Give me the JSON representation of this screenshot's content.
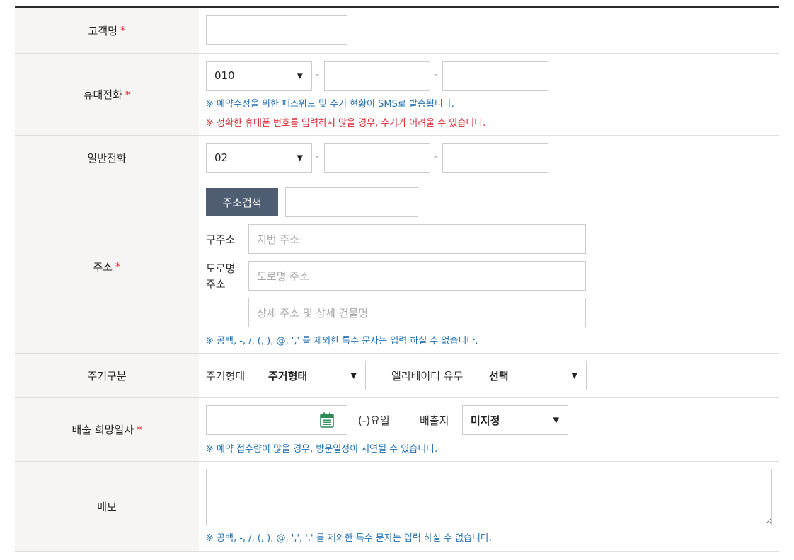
{
  "required_mark": "*",
  "rows": {
    "name": {
      "label": "고객명"
    },
    "mobile": {
      "label": "휴대전화",
      "prefix_value": "010",
      "dash": "-",
      "note_blue": "※ 예약수정을 위한 패스워드 및 수거 현황이 SMS로 발송됩니다.",
      "note_red": "※ 정확한 휴대폰 번호를 입력하지 않을 경우, 수거가 어려울 수 있습니다."
    },
    "phone": {
      "label": "일반전화",
      "prefix_value": "02",
      "dash": "-"
    },
    "address": {
      "label": "주소",
      "search_button": "주소검색",
      "old_label": "구주소",
      "old_placeholder": "지번 주소",
      "road_label_1": "도로명",
      "road_label_2": "주소",
      "road_placeholder": "도로명 주소",
      "detail_placeholder": "상세 주소 및 상세 건물명",
      "note": "※ 공백, -, /, (, ), @, ',' 를 제외한 특수 문자는 입력 하실 수 없습니다."
    },
    "residence": {
      "label": "주거구분",
      "type_label": "주거형태",
      "type_value": "주거형태",
      "elevator_label": "엘리베이터 유무",
      "elevator_value": "선택"
    },
    "discharge": {
      "label": "배출 희망일자",
      "weekday_text": "(-)요일",
      "place_label": "배출지",
      "place_value": "미지정",
      "note": "※ 예약 접수량이 많을 경우, 방문일정이 지연될 수 있습니다."
    },
    "memo": {
      "label": "메모",
      "note": "※ 공백, -, /, (, ), @, ',', '.' 를 제외한 특수 문자는 입력 하실 수 없습니다."
    }
  },
  "icons": {
    "caret": "▼",
    "calendar": "calendar-icon"
  },
  "colors": {
    "header_bg": "#f6f5f3",
    "required": "#e0303a",
    "note_blue": "#1f6fb0",
    "note_red": "#d9272e",
    "button_bg": "#4e5d71",
    "calendar_green": "#2e8b57"
  }
}
